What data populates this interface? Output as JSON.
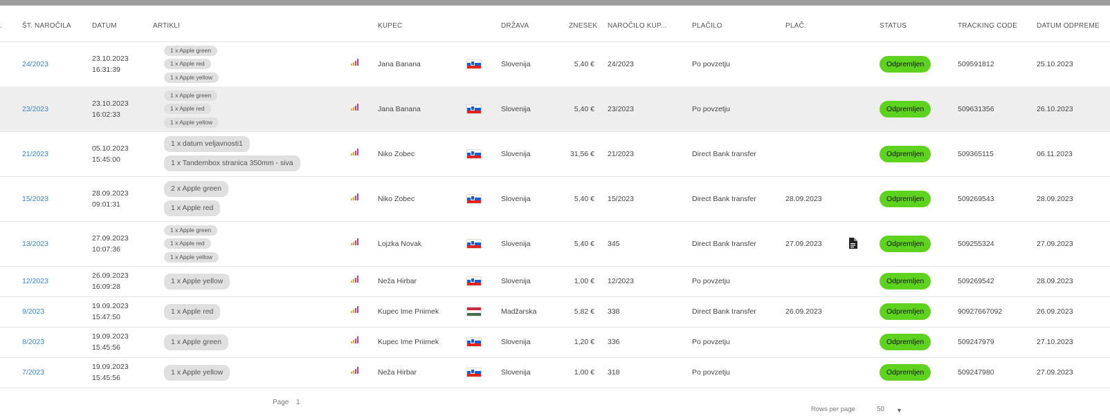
{
  "headers": {
    "cutoff": ".",
    "order_no": "ŠT. NAROČILA",
    "date": "DATUM",
    "items": "ARTIKLI",
    "buyer": "KUPEC",
    "country": "DRŽAVA",
    "amount": "ZNESEK",
    "buyer_order": "NAROČILO KUP...",
    "payment": "PLAČILO",
    "paid": "PLAČ.",
    "status": "STATUS",
    "tracking": "TRACKING CODE",
    "ship_date": "DATUM ODPREME"
  },
  "colors": {
    "status_green": "#5dd31e",
    "link_blue": "#3a86c8",
    "row_highlight": "#eeeeee"
  },
  "rows": [
    {
      "order": "24/2023",
      "date": "23.10.2023",
      "time": "16:31:39",
      "items": [
        "1 x Apple green",
        "1 x Apple red",
        "1 x Apple yellow"
      ],
      "chip_size": "sm",
      "buyer": "Jana Banana",
      "flag": "slovenia-flag-icon",
      "country": "Slovenija",
      "amount": "5,40 €",
      "buyer_order": "24/2023",
      "payment": "Po povzetju",
      "paid_date": "",
      "doc": false,
      "status": "Odpremljen",
      "tracking": "509591812",
      "ship_date": "25.10.2023"
    },
    {
      "order": "23/2023",
      "date": "23.10.2023",
      "time": "16:02:33",
      "items": [
        "1 x Apple green",
        "1 x Apple red",
        "1 x Apple yellow"
      ],
      "chip_size": "sm",
      "buyer": "Jana Banana",
      "flag": "slovenia-flag-icon",
      "country": "Slovenija",
      "amount": "5,40 €",
      "buyer_order": "23/2023",
      "payment": "Po povzetju",
      "paid_date": "",
      "doc": false,
      "status": "Odpremljen",
      "tracking": "509631356",
      "ship_date": "26.10.2023"
    },
    {
      "order": "21/2023",
      "date": "05.10.2023",
      "time": "15:45:00",
      "items": [
        "1 x datum veljavnosti1",
        "1 x Tandembox stranica 350mm - siva"
      ],
      "chip_size": "lg",
      "buyer": "Niko Zobec",
      "flag": "slovenia-flag-icon",
      "country": "Slovenija",
      "amount": "31,56 €",
      "buyer_order": "21/2023",
      "payment": "Direct Bank transfer",
      "paid_date": "",
      "doc": false,
      "status": "Odpremljen",
      "tracking": "509365115",
      "ship_date": "06.11.2023"
    },
    {
      "order": "15/2023",
      "date": "28.09.2023",
      "time": "09:01:31",
      "items": [
        "2 x Apple green",
        "1 x Apple red"
      ],
      "chip_size": "lg",
      "buyer": "Niko Zobec",
      "flag": "slovenia-flag-icon",
      "country": "Slovenija",
      "amount": "5,40 €",
      "buyer_order": "15/2023",
      "payment": "Direct Bank transfer",
      "paid_date": "28.09.2023",
      "doc": false,
      "status": "Odpremljen",
      "tracking": "509269543",
      "ship_date": "28.09.2023"
    },
    {
      "order": "13/2023",
      "date": "27.09.2023",
      "time": "10:07:36",
      "items": [
        "1 x Apple green",
        "1 x Apple red",
        "1 x Apple yellow"
      ],
      "chip_size": "sm",
      "buyer": "Lojzka Novak",
      "flag": "slovenia-flag-icon",
      "country": "Slovenija",
      "amount": "5,40 €",
      "buyer_order": "345",
      "payment": "Direct Bank transfer",
      "paid_date": "27.09.2023",
      "doc": true,
      "status": "Odpremljen",
      "tracking": "509255324",
      "ship_date": "27.09.2023"
    },
    {
      "order": "12/2023",
      "date": "26.09.2023",
      "time": "16:09:28",
      "items": [
        "1 x Apple yellow"
      ],
      "chip_size": "lg",
      "buyer": "Neža Hirbar",
      "flag": "slovenia-flag-icon",
      "country": "Slovenija",
      "amount": "1,00 €",
      "buyer_order": "12/2023",
      "payment": "Po povzetju",
      "paid_date": "",
      "doc": false,
      "status": "Odpremljen",
      "tracking": "509269542",
      "ship_date": "28.09.2023"
    },
    {
      "order": "9/2023",
      "date": "19.09.2023",
      "time": "15:47:50",
      "items": [
        "1 x Apple red"
      ],
      "chip_size": "lg",
      "buyer": "Kupec Ime Priimek",
      "flag": "hungary-flag-icon",
      "country": "Madžarska",
      "amount": "5,82 €",
      "buyer_order": "338",
      "payment": "Direct Bank transfer",
      "paid_date": "26.09.2023",
      "doc": false,
      "status": "Odpremljen",
      "tracking": "90927667092",
      "ship_date": "26.09.2023"
    },
    {
      "order": "8/2023",
      "date": "19.09.2023",
      "time": "15:45:56",
      "items": [
        "1 x Apple green"
      ],
      "chip_size": "lg",
      "buyer": "Kupec Ime Priimek",
      "flag": "slovenia-flag-icon",
      "country": "Slovenija",
      "amount": "1,20 €",
      "buyer_order": "336",
      "payment": "Po povzetju",
      "paid_date": "",
      "doc": false,
      "status": "Odpremljen",
      "tracking": "509247979",
      "ship_date": "27.10.2023"
    },
    {
      "order": "7/2023",
      "date": "19.09.2023",
      "time": "15:45:56",
      "items": [
        "1 x Apple yellow"
      ],
      "chip_size": "lg",
      "buyer": "Neža Hirbar",
      "flag": "slovenia-flag-icon",
      "country": "Slovenija",
      "amount": "1,00 €",
      "buyer_order": "318",
      "payment": "Po povzetju",
      "paid_date": "",
      "doc": false,
      "status": "Odpremljen",
      "tracking": "509247980",
      "ship_date": "27.09.2023"
    }
  ],
  "footer": {
    "page_label": "Page",
    "page_number": "1",
    "rows_per_page_label": "Rows per page",
    "rows_per_page_value": "50",
    "dropdown_icon": "chevron-down-icon"
  }
}
